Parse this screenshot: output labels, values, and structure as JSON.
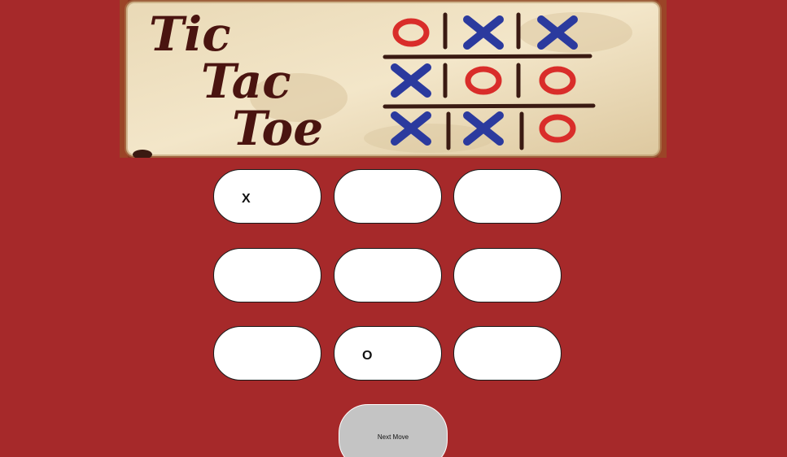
{
  "colors": {
    "page_background": "#a6292a",
    "cell_background": "#ffffff",
    "button_background": "#c4c4c4",
    "banner_x_color": "#2b3a9e",
    "banner_o_color": "#d92d2a",
    "banner_title_color": "#4a1410"
  },
  "banner": {
    "title_line1": "Tic",
    "title_line2": "Tac",
    "title_line3": "Toe",
    "board": [
      [
        "O",
        "X",
        "X"
      ],
      [
        "X",
        "O",
        "O"
      ],
      [
        "X",
        "X",
        "O"
      ]
    ]
  },
  "board": {
    "cells": [
      {
        "value": "X"
      },
      {
        "value": ""
      },
      {
        "value": ""
      },
      {
        "value": ""
      },
      {
        "value": ""
      },
      {
        "value": ""
      },
      {
        "value": ""
      },
      {
        "value": "O"
      },
      {
        "value": ""
      }
    ]
  },
  "controls": {
    "next_move_label": "Next Move"
  }
}
